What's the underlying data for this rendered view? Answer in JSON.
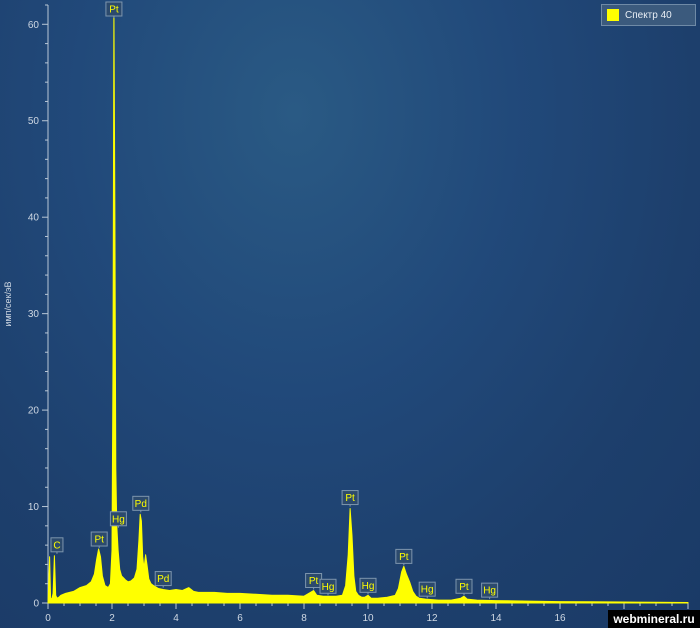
{
  "legend": {
    "label": "Спектр 40",
    "color": "#ffff00"
  },
  "watermark": "webmineral.ru",
  "chart_data": {
    "type": "area",
    "ylabel": "имп/сек/эВ",
    "xlabel": "",
    "xlim": [
      0,
      20
    ],
    "ylim": [
      0,
      62
    ],
    "x_ticks": [
      0,
      2,
      4,
      6,
      8,
      10,
      12,
      14,
      16
    ],
    "y_ticks": [
      0,
      10,
      20,
      30,
      40,
      50,
      60
    ],
    "grid": false,
    "series": [
      {
        "name": "Спектр 40",
        "color": "#ffff00",
        "x": [
          0.0,
          0.05,
          0.08,
          0.12,
          0.16,
          0.2,
          0.24,
          0.27,
          0.3,
          0.34,
          0.4,
          0.55,
          0.8,
          1.0,
          1.2,
          1.35,
          1.45,
          1.52,
          1.58,
          1.64,
          1.7,
          1.78,
          1.88,
          1.95,
          2.0,
          2.03,
          2.06,
          2.09,
          2.12,
          2.15,
          2.19,
          2.24,
          2.3,
          2.36,
          2.42,
          2.5,
          2.6,
          2.7,
          2.78,
          2.84,
          2.88,
          2.92,
          2.96,
          3.0,
          3.05,
          3.1,
          3.15,
          3.22,
          3.3,
          3.45,
          3.6,
          3.8,
          4.0,
          4.2,
          4.4,
          4.55,
          4.7,
          4.9,
          5.2,
          5.6,
          6.0,
          6.5,
          7.0,
          7.5,
          8.0,
          8.2,
          8.3,
          8.4,
          8.6,
          9.0,
          9.2,
          9.3,
          9.38,
          9.44,
          9.5,
          9.56,
          9.62,
          9.7,
          9.8,
          9.9,
          10.0,
          10.1,
          10.3,
          10.6,
          10.85,
          10.95,
          11.05,
          11.12,
          11.2,
          11.3,
          11.4,
          11.5,
          11.6,
          11.8,
          12.2,
          12.6,
          12.9,
          13.0,
          13.1,
          13.4,
          14.0,
          15.0,
          16.0,
          17.0,
          18.0,
          19.0,
          20.0
        ],
        "values": [
          0.0,
          4.8,
          0.5,
          0.4,
          1.0,
          4.9,
          0.8,
          0.6,
          0.5,
          0.6,
          0.8,
          1.0,
          1.2,
          1.6,
          1.8,
          2.2,
          3.0,
          4.5,
          5.6,
          4.8,
          2.8,
          1.8,
          1.6,
          2.0,
          5.5,
          25.0,
          62.0,
          40.0,
          14.0,
          8.0,
          5.5,
          3.5,
          2.8,
          2.6,
          2.4,
          2.2,
          2.3,
          2.6,
          3.5,
          6.5,
          9.2,
          8.5,
          4.8,
          3.6,
          5.0,
          3.8,
          2.5,
          2.0,
          1.8,
          1.5,
          1.4,
          1.3,
          1.4,
          1.3,
          1.6,
          1.2,
          1.1,
          1.1,
          1.1,
          1.0,
          1.0,
          0.9,
          0.8,
          0.8,
          0.7,
          1.1,
          1.3,
          0.8,
          0.7,
          0.7,
          0.8,
          1.8,
          5.0,
          9.8,
          7.0,
          2.8,
          1.2,
          0.8,
          0.6,
          0.6,
          0.8,
          0.5,
          0.5,
          0.6,
          0.8,
          1.5,
          3.2,
          3.8,
          3.0,
          2.2,
          1.2,
          0.7,
          0.5,
          0.4,
          0.3,
          0.3,
          0.5,
          0.7,
          0.4,
          0.3,
          0.25,
          0.2,
          0.15,
          0.12,
          0.1,
          0.08,
          0.05
        ]
      }
    ],
    "annotations": [
      {
        "text": "C",
        "x": 0.28,
        "y": 5.1
      },
      {
        "text": "Pt",
        "x": 1.6,
        "y": 5.7
      },
      {
        "text": "Pt",
        "x": 2.06,
        "y": 62.0
      },
      {
        "text": "Hg",
        "x": 2.2,
        "y": 7.8
      },
      {
        "text": "Pd",
        "x": 2.9,
        "y": 9.4
      },
      {
        "text": "Pd",
        "x": 3.6,
        "y": 1.6
      },
      {
        "text": "Pt",
        "x": 8.3,
        "y": 1.4
      },
      {
        "text": "Hg",
        "x": 8.75,
        "y": 0.8
      },
      {
        "text": "Pt",
        "x": 9.44,
        "y": 10.0
      },
      {
        "text": "Hg",
        "x": 10.0,
        "y": 0.9
      },
      {
        "text": "Pt",
        "x": 11.12,
        "y": 3.9
      },
      {
        "text": "Hg",
        "x": 11.85,
        "y": 0.5
      },
      {
        "text": "Pt",
        "x": 13.0,
        "y": 0.8
      },
      {
        "text": "Hg",
        "x": 13.8,
        "y": 0.4
      }
    ]
  }
}
